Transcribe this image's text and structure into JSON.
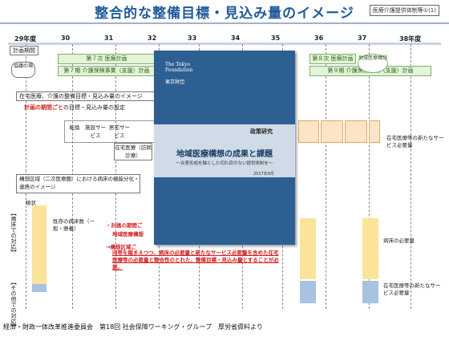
{
  "header": {
    "title": "整合的な整備目標・見込み量のイメージ",
    "tag": "医療介護提供体制等①(1)"
  },
  "years": [
    "29年度",
    "30",
    "31",
    "32",
    "33",
    "34",
    "35",
    "36",
    "37",
    "38年度"
  ],
  "plan_rows": {
    "label": "計画期間",
    "cooperation": "協議の場",
    "med7": "第７次 医療計画",
    "mid_review": "〔中間見直し〕",
    "care7": "第７期 介護保険事業（支援）計画",
    "med8": "第８次 医療計画",
    "care9": "第９期 介護保険事業（支援）計画",
    "regional_plan": "地域医療構想"
  },
  "targets": {
    "heading": "在宅医療、介護の整備目標・見込み量のイメージ",
    "sub_red": "計画の期間ごと",
    "sub_rest": "の目標・見込み量の設定",
    "col1": "転換",
    "col2": "施設サービス",
    "col3": "居宅サービス",
    "home_care": "在宅医療（訪問診療）",
    "new_need": "在宅医療等の新たなサービス必要量"
  },
  "region": {
    "box": "構想区域（二次医療圏）における病床の機能分化・連携のイメージ",
    "existing": "現状",
    "existing_beds": "既存の病床数（一般・療養）",
    "beds_needed": "病床の必要量",
    "vertical_beds": "【病床での対応】",
    "vertical_other": "【その他での対応】",
    "new_need2": "在宅医療等の新たなサービス必要量",
    "bullet1_red": "・計画の期間ご",
    "bullet1_b": "地域医療構想",
    "bullet2_red": "→構想区域ご",
    "bullet2_text": "向等を踏まえつつ、病床の必要量と新たなサービス必要量を含めた在宅医療等の必要量と整合性のとれた、整備目標・見込み量とすることが必要。"
  },
  "book": {
    "publisher_small": "The Tokyo Foundation",
    "publisher_jp": "東京財団",
    "series": "政策研究",
    "title": "地域医療構想の成果と課題",
    "subtitle": "〜合意形成を軸とした切れ目のない提供体制を〜",
    "date": "2017年8月"
  },
  "footer": "経済・財政一体改革推進委員会　第18回 社会保障ワーキング・グループ　厚労省資料より"
}
